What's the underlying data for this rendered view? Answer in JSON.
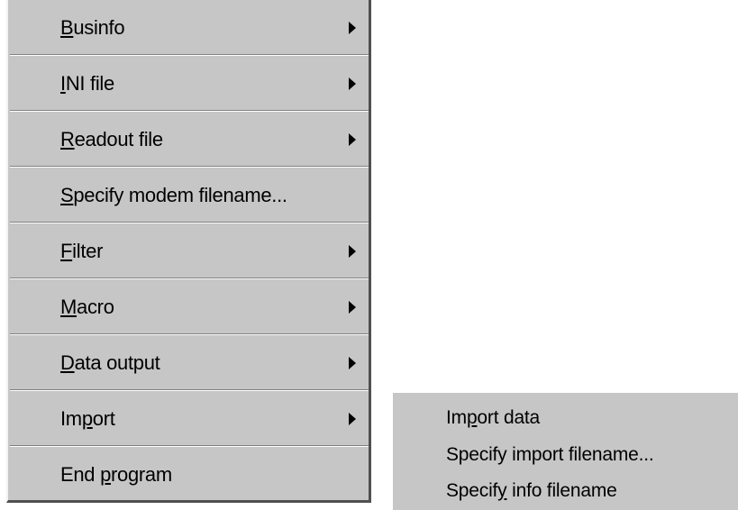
{
  "main_menu": {
    "items": [
      {
        "pre": "",
        "key": "B",
        "post": "usinfo",
        "submenu": true
      },
      {
        "pre": "",
        "key": "I",
        "post": "NI file",
        "submenu": true
      },
      {
        "pre": "",
        "key": "R",
        "post": "eadout file",
        "submenu": true
      },
      {
        "pre": "",
        "key": "S",
        "post": "pecify modem filename...",
        "submenu": false
      },
      {
        "pre": "",
        "key": "F",
        "post": "ilter",
        "submenu": true
      },
      {
        "pre": "",
        "key": "M",
        "post": "acro",
        "submenu": true
      },
      {
        "pre": "",
        "key": "D",
        "post": "ata output",
        "submenu": true
      },
      {
        "pre": "Im",
        "key": "p",
        "post": "ort",
        "submenu": true
      },
      {
        "pre": "End ",
        "key": "p",
        "post": "rogram",
        "submenu": false
      }
    ]
  },
  "import_submenu": {
    "items": [
      {
        "pre": "Im",
        "key": "p",
        "post": "ort data"
      },
      {
        "pre": "Specify import filename...",
        "key": "",
        "post": ""
      },
      {
        "pre": "Specif",
        "key": "y",
        "post": " info filename"
      }
    ]
  },
  "colors": {
    "menu_bg": "#c6c6c6",
    "text": "#000000",
    "highlight": "#ffffff",
    "shadow": "#808080"
  }
}
